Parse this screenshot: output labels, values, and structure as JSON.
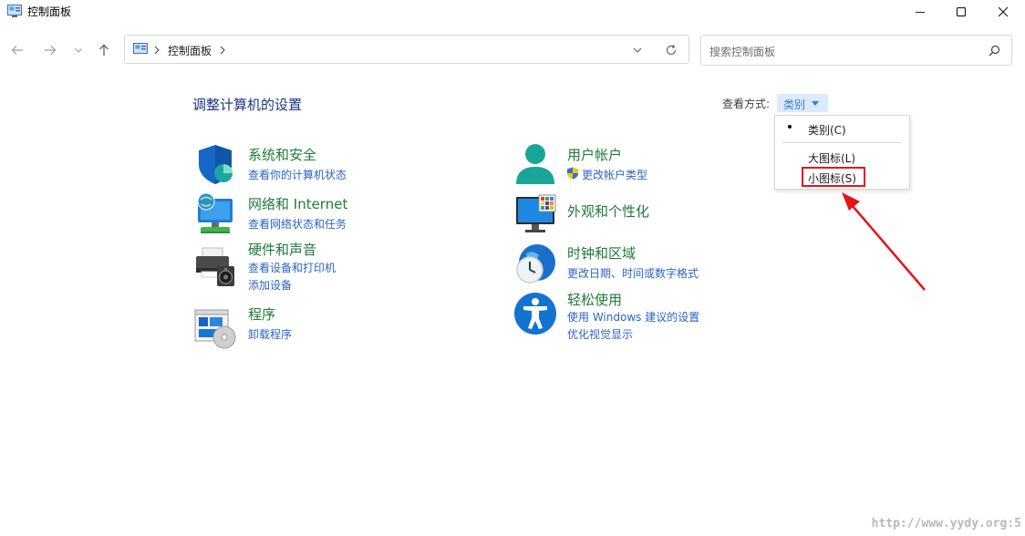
{
  "window": {
    "title": "控制面板",
    "minimize_icon": "minimize-icon",
    "maximize_icon": "maximize-icon",
    "close_icon": "close-icon"
  },
  "nav": {
    "breadcrumb": "控制面板",
    "search_placeholder": "搜索控制面板"
  },
  "main": {
    "page_title": "调整计算机的设置",
    "view_by_label": "查看方式:",
    "view_by_value": "类别"
  },
  "view_menu": {
    "items": [
      {
        "label": "类别(C)",
        "selected": true
      },
      {
        "label": "大图标(L)",
        "selected": false
      },
      {
        "label": "小图标(S)",
        "selected": false
      }
    ]
  },
  "categories": [
    {
      "title": "系统和安全",
      "icon": "shield-icon",
      "links": [
        "查看你的计算机状态"
      ]
    },
    {
      "title": "网络和 Internet",
      "icon": "network-icon",
      "links": [
        "查看网络状态和任务"
      ]
    },
    {
      "title": "硬件和声音",
      "icon": "printer-icon",
      "links": [
        "查看设备和打印机",
        "添加设备"
      ]
    },
    {
      "title": "程序",
      "icon": "programs-icon",
      "links": [
        "卸载程序"
      ]
    },
    {
      "title": "用户帐户",
      "icon": "user-icon",
      "links": [
        "更改帐户类型"
      ]
    },
    {
      "title": "外观和个性化",
      "icon": "monitor-icon",
      "links": []
    },
    {
      "title": "时钟和区域",
      "icon": "clock-globe-icon",
      "links": [
        "更改日期、时间或数字格式"
      ]
    },
    {
      "title": "轻松使用",
      "icon": "accessibility-icon",
      "links": [
        "使用 Windows 建议的设置",
        "优化视觉显示"
      ]
    }
  ],
  "colors": {
    "category_title": "#1e7a37",
    "link": "#2b64c8",
    "page_title": "#1e3287",
    "annotation": "#e5141b"
  },
  "watermark": "http://www.yydy.org:5"
}
